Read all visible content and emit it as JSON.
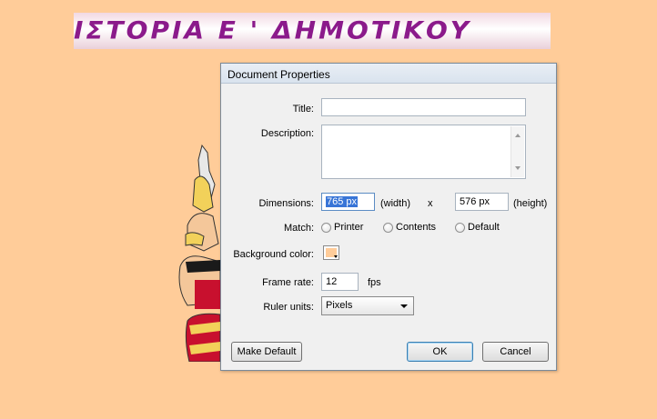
{
  "banner": {
    "text": "ΙΣΤΟΡΙΑ Ε ' ΔΗΜΟΤΙΚΟΥ"
  },
  "dialog": {
    "title": "Document Properties",
    "title_field": {
      "label": "Title:",
      "value": ""
    },
    "description_field": {
      "label": "Description:",
      "value": ""
    },
    "dimensions": {
      "label": "Dimensions:",
      "width_value": "765 px",
      "width_unit": "(width)",
      "separator": "x",
      "height_value": "576 px",
      "height_unit": "(height)"
    },
    "match": {
      "label": "Match:",
      "options": [
        "Printer",
        "Contents",
        "Default"
      ]
    },
    "background": {
      "label": "Background color:",
      "color": "#ffcc99"
    },
    "frame_rate": {
      "label": "Frame rate:",
      "value": "12",
      "unit": "fps"
    },
    "ruler_units": {
      "label": "Ruler units:",
      "selected": "Pixels"
    },
    "buttons": {
      "make_default": "Make Default",
      "ok": "OK",
      "cancel": "Cancel"
    }
  }
}
